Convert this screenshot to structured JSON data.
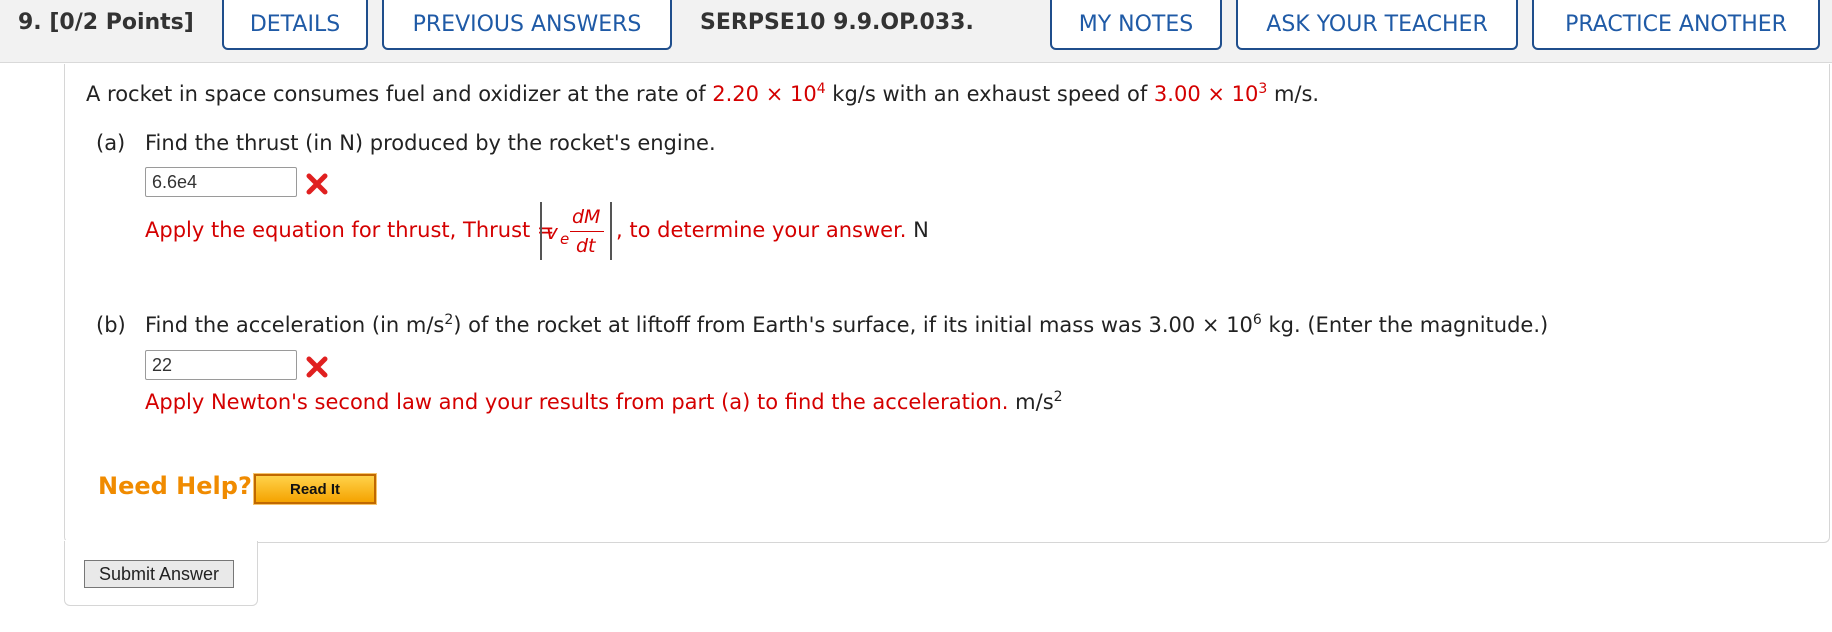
{
  "header": {
    "question_number": "9.",
    "points": "[0/2 Points]",
    "buttons": {
      "details": "DETAILS",
      "previous_answers": "PREVIOUS ANSWERS",
      "my_notes": "MY NOTES",
      "ask_teacher": "ASK YOUR TEACHER",
      "practice_another": "PRACTICE ANOTHER"
    },
    "problem_code": "SERPSE10 9.9.OP.033."
  },
  "problem": {
    "intro_a": "A rocket in space consumes fuel and oxidizer at the rate of ",
    "rate_value": "2.20 × 10",
    "rate_exp": "4",
    "intro_b": " kg/s with an exhaust speed of ",
    "speed_value": "3.00 × 10",
    "speed_exp": "3",
    "intro_c": " m/s."
  },
  "part_a": {
    "label": "(a)",
    "question": "Find the thrust (in N) produced by the rocket's engine.",
    "answer": "6.6e4",
    "feedback_a": "Apply the equation for thrust, Thrust =",
    "var_v": "v",
    "var_e": "e",
    "numerator": "dM",
    "denominator": "dt",
    "feedback_b": ", to determine your answer.",
    "unit": "N"
  },
  "part_b": {
    "label": "(b)",
    "question_a": "Find the acceleration (in m/s",
    "question_exp": "2",
    "question_b": ") of the rocket at liftoff from Earth's surface, if its initial mass was 3.00 × 10",
    "mass_exp": "6",
    "question_c": " kg. (Enter the magnitude.)",
    "answer": "22",
    "feedback": "Apply Newton's second law and your results from part (a) to find the acceleration.",
    "unit": "m/s",
    "unit_exp": "2"
  },
  "help": {
    "label": "Need Help?",
    "read_it": "Read It"
  },
  "submit": "Submit Answer",
  "colors": {
    "accent_blue": "#1f5aa6",
    "error_red": "#d40000",
    "help_orange": "#f08b00"
  }
}
